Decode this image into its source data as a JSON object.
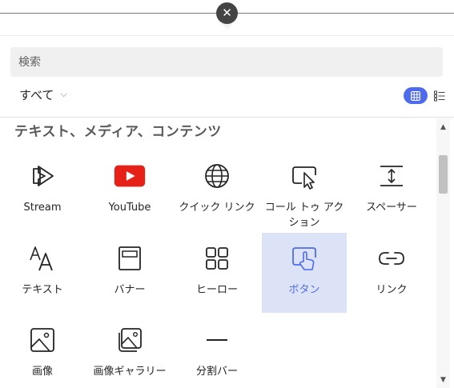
{
  "close_icon": "close-icon",
  "search": {
    "placeholder": "検索"
  },
  "filter": {
    "label": "すべて",
    "chevron": "⌵"
  },
  "view_toggle": {
    "grid_icon": "grid-icon",
    "list_icon": "list-icon",
    "active": "grid"
  },
  "colors": {
    "accent": "#4f6bed",
    "selected_bg": "#dde3f7",
    "youtube_red": "#e62117"
  },
  "section": {
    "title": "テキスト、メディア、コンテンツ",
    "items": [
      {
        "label": "Stream",
        "icon": "stream-icon"
      },
      {
        "label": "YouTube",
        "icon": "youtube-icon"
      },
      {
        "label": "クイック リンク",
        "icon": "globe-icon"
      },
      {
        "label": "コール トゥ アクション",
        "icon": "call-to-action-icon"
      },
      {
        "label": "スペーサー",
        "icon": "spacer-icon"
      },
      {
        "label": "テキスト",
        "icon": "text-icon"
      },
      {
        "label": "バナー",
        "icon": "banner-icon"
      },
      {
        "label": "ヒーロー",
        "icon": "hero-icon"
      },
      {
        "label": "ボタン",
        "icon": "button-icon",
        "selected": true
      },
      {
        "label": "リンク",
        "icon": "link-icon"
      },
      {
        "label": "画像",
        "icon": "image-icon"
      },
      {
        "label": "画像ギャラリー",
        "icon": "image-gallery-icon"
      },
      {
        "label": "分割バー",
        "icon": "divider-icon"
      }
    ]
  }
}
